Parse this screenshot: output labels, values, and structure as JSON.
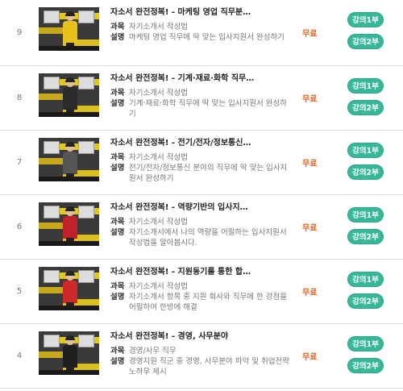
{
  "rows": [
    {
      "number": "9",
      "title": "자소서 완전정복! - 마케팅 영업 직무분…",
      "subject_label": "과목",
      "subject": "자기소개서 작성법",
      "desc_label": "설명",
      "desc": "마케팅 영업 직무에 딱 맞는 입사지원서 완성하기",
      "price": "무료",
      "btn1": "강의1부",
      "btn2": "강의2부",
      "outfit_color": "#e8c21c"
    },
    {
      "number": "8",
      "title": "자소서 완전정복! - 기계·재료·화학 직무…",
      "subject_label": "과목",
      "subject": "자기소개서 작성법",
      "desc_label": "설명",
      "desc": "기계·재료·화학 직무에 딱 맞는 입사지원서 완성하기",
      "price": "무료",
      "btn1": "강의1부",
      "btn2": "강의2부",
      "outfit_color": "#2b2b2b"
    },
    {
      "number": "7",
      "title": "자소서 완전정복! - 전기/전자/정보통신…",
      "subject_label": "과목",
      "subject": "자기소개서 작성법",
      "desc_label": "설명",
      "desc": "전기/전자/정보통신 분야의 직무에 딱 맞는 입사지원서 완성하기",
      "price": "무료",
      "btn1": "강의1부",
      "btn2": "강의2부",
      "outfit_color": "#555555"
    },
    {
      "number": "6",
      "title": "자소서 완전정복! - 역량기반의 입사지…",
      "subject_label": "과목",
      "subject": "자기소개서 작성법",
      "desc_label": "설명",
      "desc": "자기소개서에서 나의 역량을 어필하는 입사지원서 작성법을 알아봅시다.",
      "price": "무료",
      "btn1": "강의1부",
      "btn2": "강의2부",
      "outfit_color": "#c0222a"
    },
    {
      "number": "5",
      "title": "자소서 완전정복! - 지원동기를 통한 합…",
      "subject_label": "과목",
      "subject": "자기소개서 작성법",
      "desc_label": "설명",
      "desc": "자기소개서 항목 중 지원 회사와 직무에 한 강점을 어필하여 한방에 해결",
      "price": "무료",
      "btn1": "강의1부",
      "btn2": "강의2부",
      "outfit_color": "#cf2a2a"
    },
    {
      "number": "4",
      "title": "자소서 완전정복! - 경영, 사무분야",
      "subject_label": "과목",
      "subject": "경영/사무 직무",
      "desc_label": "설명",
      "desc": "경영지원 직군 중 경영, 사무분야 파악 및 취업전략 노하우 제시",
      "price": "무료",
      "btn1": "강의1부",
      "btn2": "강의2부",
      "outfit_color": "#1f1f1f"
    }
  ],
  "colors": {
    "accent_button": "#36b899",
    "price_text": "#e8601c"
  }
}
